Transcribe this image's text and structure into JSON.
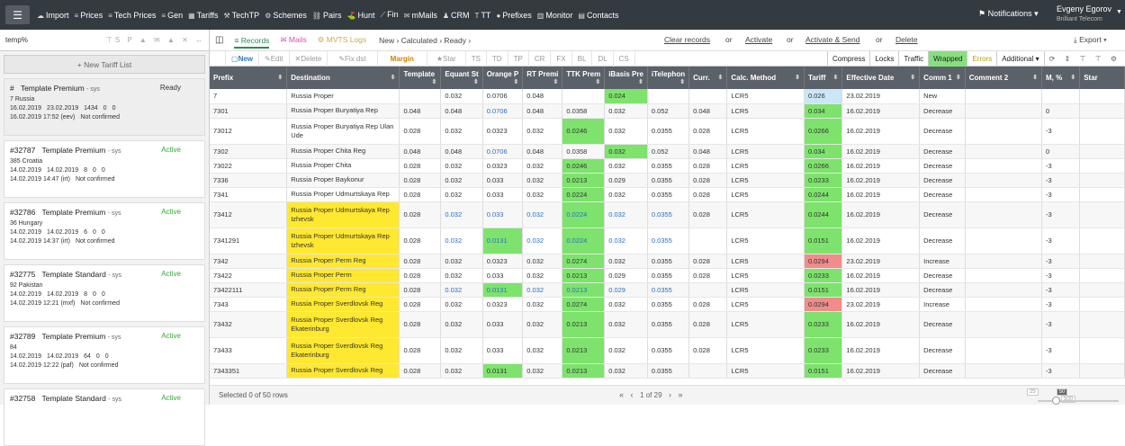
{
  "topbar": {
    "menu": [
      {
        "icon": "cloud-upload-icon",
        "g": "☁",
        "label": "Import"
      },
      {
        "icon": "list-icon",
        "g": "≡",
        "label": "Prices"
      },
      {
        "icon": "list-icon",
        "g": "≡",
        "label": "Tech Prices"
      },
      {
        "icon": "list-icon",
        "g": "≡",
        "label": "Gen"
      },
      {
        "icon": "grid-icon",
        "g": "▦",
        "label": "Tariffs"
      },
      {
        "icon": "tools-icon",
        "g": "⚒",
        "label": "TechTP"
      },
      {
        "icon": "cogs-icon",
        "g": "⚙",
        "label": "Schemes"
      },
      {
        "icon": "link-icon",
        "g": "⛓",
        "label": "Pairs"
      },
      {
        "icon": "binoculars-icon",
        "g": "⛳",
        "label": "Hunt"
      },
      {
        "icon": "chart-icon",
        "g": "⟋",
        "label": "Fin"
      },
      {
        "icon": "envelope-icon",
        "g": "✉",
        "label": "mMails"
      },
      {
        "icon": "user-icon",
        "g": "♟",
        "label": "CRM"
      },
      {
        "icon": "tt-icon",
        "g": "T",
        "label": "TT"
      },
      {
        "icon": "circle-icon",
        "g": "●",
        "label": "Prefixes"
      },
      {
        "icon": "bar-chart-icon",
        "g": "▥",
        "label": "Monitor"
      },
      {
        "icon": "contacts-icon",
        "g": "▤",
        "label": "Contacts"
      }
    ],
    "notifications": "Notifications",
    "user_name": "Evgeny Egorov",
    "user_company": "Brilliant Telecom"
  },
  "sidebar": {
    "search": "temp%",
    "new_list": "+ New Tariff List",
    "cards": [
      {
        "hash": "#",
        "name": "Template Premium",
        "sys": "- sys",
        "status": "Ready",
        "country": "7 Russia",
        "d1": "16.02.2019",
        "d2": "23.02.2019",
        "c1": "1434",
        "c2": "0",
        "c3": "0",
        "ts": "16.02.2019 17:52 (eev)",
        "conf": "Not confirmed",
        "cls": "ready"
      },
      {
        "hash": "#32787",
        "name": "Template Premium",
        "sys": "- sys",
        "status": "Active",
        "country": "385 Croatia",
        "d1": "14.02.2019",
        "d2": "14.02.2019",
        "c1": "8",
        "c2": "0",
        "c3": "0",
        "ts": "14.02.2019 14:47 (irt)",
        "conf": "Not confirmed",
        "cls": "active"
      },
      {
        "hash": "#32786",
        "name": "Template Premium",
        "sys": "- sys",
        "status": "Active",
        "country": "36 Hungary",
        "d1": "14.02.2019",
        "d2": "14.02.2019",
        "c1": "6",
        "c2": "0",
        "c3": "0",
        "ts": "14.02.2019 14:37 (irt)",
        "conf": "Not confirmed",
        "cls": "active"
      },
      {
        "hash": "#32775",
        "name": "Template Standard",
        "sys": "- sys",
        "status": "Active",
        "country": "92 Pakistan",
        "d1": "14.02.2019",
        "d2": "14.02.2019",
        "c1": "8",
        "c2": "0",
        "c3": "0",
        "ts": "14.02.2019 12:21 (mxf)",
        "conf": "Not confirmed",
        "cls": "active"
      },
      {
        "hash": "#32789",
        "name": "Template Premium",
        "sys": "- sys",
        "status": "Active",
        "country": "84",
        "d1": "14.02.2019",
        "d2": "14.02.2019",
        "c1": "64",
        "c2": "0",
        "c3": "0",
        "ts": "14.02.2019 12:22 (paf)",
        "conf": "Not confirmed",
        "cls": "active"
      },
      {
        "hash": "#32758",
        "name": "Template Standard",
        "sys": "- sys",
        "status": "Active",
        "country": "",
        "d1": "",
        "d2": "",
        "c1": "",
        "c2": "",
        "c3": "",
        "ts": "",
        "conf": "",
        "cls": "active"
      }
    ]
  },
  "toolbar": {
    "records": "Records",
    "mails": "Mails",
    "mvts": "MVTS Logs",
    "crumbs": "New  ›  Calculated  ›  Ready  ›",
    "clear": "Clear records",
    "activate": "Activate",
    "activate_send": "Activate & Send",
    "delete": "Delete",
    "or": "or",
    "export": "Export"
  },
  "toolbar2": {
    "new": "New",
    "edit": "Edit",
    "delete": "Delete",
    "fixdst": "Fix dst",
    "margin": "Margin",
    "star": "Star",
    "tags": [
      "TS",
      "TD",
      "TP",
      "CR",
      "FX",
      "BL",
      "DL",
      "CS"
    ],
    "right": [
      "Compress",
      "Locks",
      "Traffic",
      "Wrapped",
      "Errors",
      "Additional ▾"
    ]
  },
  "columns": [
    "Prefix",
    "Destination",
    "Template",
    "Equant St",
    "Orange P",
    "RT Premi",
    "TTK Prem",
    "iBasis Pre",
    "iTelephon",
    "Curr.",
    "Calc. Method",
    "Tariff",
    "Effective Date",
    "Comm 1",
    "Comment 2",
    "M, %",
    "Star"
  ],
  "rows": [
    [
      "7",
      "Russia Proper",
      "",
      "0.032",
      "0.0706",
      "0.048",
      "",
      "0.024",
      "",
      "",
      "LCR5",
      "0.026",
      "23.02.2019",
      "New",
      "",
      "",
      ""
    ],
    [
      "7301",
      "Russia Proper Buryatiya Rep",
      "0.048",
      "0.048",
      "0.0706",
      "0.048",
      "0.0358",
      "0.032",
      "0.052",
      "0.048",
      "LCR5",
      "0.034",
      "16.02.2019",
      "Decrease",
      "",
      "0",
      ""
    ],
    [
      "73012",
      "Russia Proper Buryatiya Rep Ulan Ude",
      "0.028",
      "0.032",
      "0.0323",
      "0.032",
      "0.0246",
      "0.032",
      "0.0355",
      "0.028",
      "LCR5",
      "0.0266",
      "16.02.2019",
      "Decrease",
      "",
      "-3",
      ""
    ],
    [
      "7302",
      "Russia Proper Chita Reg",
      "0.048",
      "0.048",
      "0.0706",
      "0.048",
      "0.0358",
      "0.032",
      "0.052",
      "0.048",
      "LCR5",
      "0.034",
      "16.02.2019",
      "Decrease",
      "",
      "0",
      ""
    ],
    [
      "73022",
      "Russia Proper Chita",
      "0.028",
      "0.032",
      "0.0323",
      "0.032",
      "0.0246",
      "0.032",
      "0.0355",
      "0.028",
      "LCR5",
      "0.0266",
      "16.02.2019",
      "Decrease",
      "",
      "-3",
      ""
    ],
    [
      "7336",
      "Russia Proper Baykonur",
      "0.028",
      "0.032",
      "0.033",
      "0.032",
      "0.0213",
      "0.029",
      "0.0355",
      "0.028",
      "LCR5",
      "0.0233",
      "16.02.2019",
      "Decrease",
      "",
      "-3",
      ""
    ],
    [
      "7341",
      "Russia Proper Udmurtskaya Rep",
      "0.028",
      "0.032",
      "0.033",
      "0.032",
      "0.0224",
      "0.032",
      "0.0355",
      "0.028",
      "LCR5",
      "0.0244",
      "16.02.2019",
      "Decrease",
      "",
      "-3",
      ""
    ],
    [
      "73412",
      "Russia Proper Udmurtskaya Rep Izhevsk",
      "0.028",
      "0.032",
      "0.033",
      "0.032",
      "0.0224",
      "0.032",
      "0.0355",
      "0.028",
      "LCR5",
      "0.0244",
      "16.02.2019",
      "Decrease",
      "",
      "-3",
      ""
    ],
    [
      "7341291",
      "Russia Proper Udmurtskaya Rep Izhevsk",
      "0.028",
      "0.032",
      "0.0131",
      "0.032",
      "0.0224",
      "0.032",
      "0.0355",
      "",
      "LCR5",
      "0.0151",
      "16.02.2019",
      "Decrease",
      "",
      "-3",
      ""
    ],
    [
      "7342",
      "Russia Proper Perm Reg",
      "0.028",
      "0.032",
      "0.0323",
      "0.032",
      "0.0274",
      "0.032",
      "0.0355",
      "0.028",
      "LCR5",
      "0.0294",
      "23.02.2019",
      "Increase",
      "",
      "-3",
      ""
    ],
    [
      "73422",
      "Russia Proper Perm",
      "0.028",
      "0.032",
      "0.033",
      "0.032",
      "0.0213",
      "0.029",
      "0.0355",
      "0.028",
      "LCR5",
      "0.0233",
      "16.02.2019",
      "Decrease",
      "",
      "-3",
      ""
    ],
    [
      "73422111",
      "Russia Proper Perm Reg",
      "0.028",
      "0.032",
      "0.0131",
      "0.032",
      "0.0213",
      "0.029",
      "0.0355",
      "",
      "LCR5",
      "0.0151",
      "16.02.2019",
      "Decrease",
      "",
      "-3",
      ""
    ],
    [
      "7343",
      "Russia Proper Sverdlovsk Reg",
      "0.028",
      "0.032",
      "0.0323",
      "0.032",
      "0.0274",
      "0.032",
      "0.0355",
      "0.028",
      "LCR5",
      "0.0294",
      "23.02.2019",
      "Increase",
      "",
      "-3",
      ""
    ],
    [
      "73432",
      "Russia Proper Sverdlovsk Reg Ekaterinburg",
      "0.028",
      "0.032",
      "0.033",
      "0.032",
      "0.0213",
      "0.032",
      "0.0355",
      "0.028",
      "LCR5",
      "0.0233",
      "16.02.2019",
      "Decrease",
      "",
      "-3",
      ""
    ],
    [
      "73433",
      "Russia Proper Sverdlovsk Reg Ekaterinburg",
      "0.028",
      "0.032",
      "0.033",
      "0.032",
      "0.0213",
      "0.032",
      "0.0355",
      "0.028",
      "LCR5",
      "0.0233",
      "16.02.2019",
      "Decrease",
      "",
      "-3",
      ""
    ],
    [
      "7343351",
      "Russia Proper Sverdlovsk Reg",
      "0.028",
      "0.032",
      "0.0131",
      "0.032",
      "0.0213",
      "0.032",
      "0.0355",
      "",
      "LCR5",
      "0.0151",
      "16.02.2019",
      "Decrease",
      "",
      "-3",
      ""
    ]
  ],
  "footer": {
    "selected": "Selected 0 of 50 rows",
    "page": "1 of 29",
    "zoom": [
      "25",
      "50",
      "500"
    ]
  },
  "colors": {
    "yellow": "#ffe830",
    "green": "#7de36c",
    "red": "#f08c8c",
    "lightblue": "#cbe6f7",
    "link": "#2a6fc0"
  }
}
